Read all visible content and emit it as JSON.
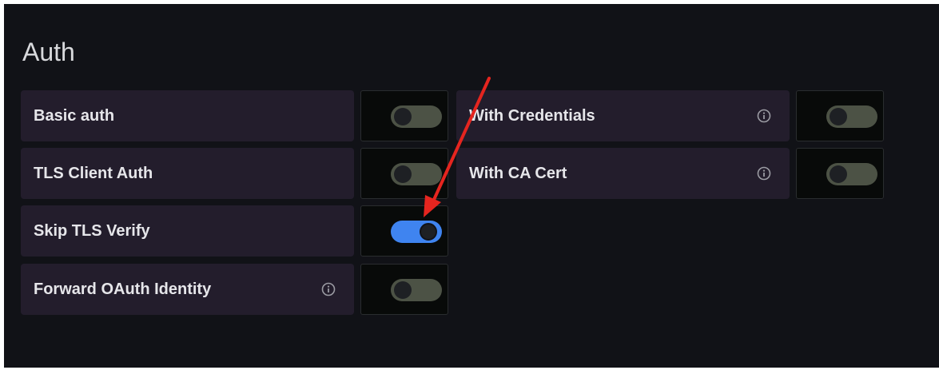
{
  "section": {
    "title": "Auth"
  },
  "left_column": [
    {
      "label": "Basic auth",
      "enabled": false,
      "info": false
    },
    {
      "label": "TLS Client Auth",
      "enabled": false,
      "info": false
    },
    {
      "label": "Skip TLS Verify",
      "enabled": true,
      "info": false
    },
    {
      "label": "Forward OAuth Identity",
      "enabled": false,
      "info": true
    }
  ],
  "right_column": [
    {
      "label": "With Credentials",
      "enabled": false,
      "info": true
    },
    {
      "label": "With CA Cert",
      "enabled": false,
      "info": true
    }
  ],
  "icons": {
    "info": "info-circle-icon"
  },
  "colors": {
    "panel_bg": "#111217",
    "label_bg": "#231d2c",
    "switch_off": "#4c5245",
    "switch_on": "#3f84f0",
    "annotation_arrow": "#e5251f"
  }
}
